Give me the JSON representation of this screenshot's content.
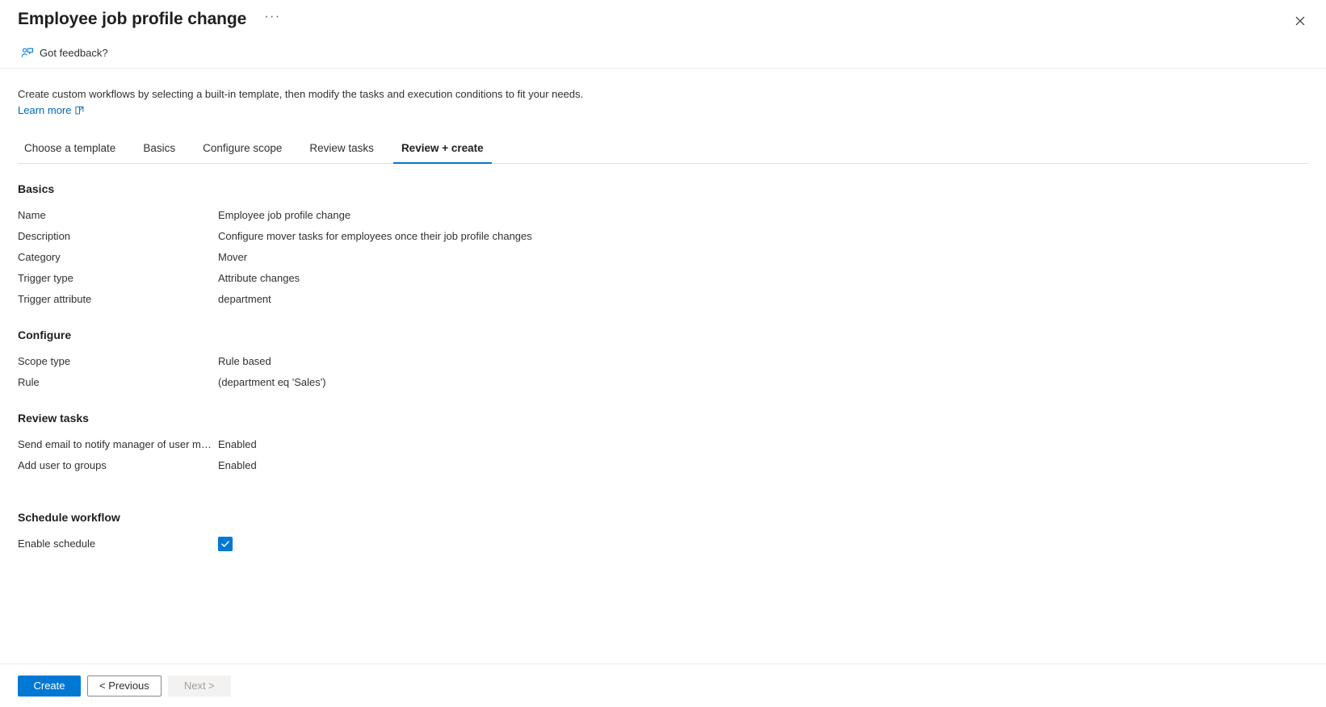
{
  "blade": {
    "title": "Employee job profile change",
    "ellipsis_label": "···",
    "close_label": "Close"
  },
  "commandbar": {
    "feedback_label": "Got feedback?"
  },
  "intro": {
    "text": "Create custom workflows by selecting a built-in template, then modify the tasks and execution conditions to fit your needs.",
    "learn_more_label": "Learn more"
  },
  "tabs": [
    {
      "label": "Choose a template",
      "active": false
    },
    {
      "label": "Basics",
      "active": false
    },
    {
      "label": "Configure scope",
      "active": false
    },
    {
      "label": "Review tasks",
      "active": false
    },
    {
      "label": "Review + create",
      "active": true
    }
  ],
  "sections": {
    "basics": {
      "title": "Basics",
      "rows": [
        {
          "key": "Name",
          "value": "Employee job profile change"
        },
        {
          "key": "Description",
          "value": "Configure mover tasks for employees once their job profile changes"
        },
        {
          "key": "Category",
          "value": "Mover"
        },
        {
          "key": "Trigger type",
          "value": "Attribute changes"
        },
        {
          "key": "Trigger attribute",
          "value": "department"
        }
      ]
    },
    "configure": {
      "title": "Configure",
      "rows": [
        {
          "key": "Scope type",
          "value": "Rule based"
        },
        {
          "key": "Rule",
          "value": "(department eq 'Sales')"
        }
      ]
    },
    "review_tasks": {
      "title": "Review tasks",
      "rows": [
        {
          "key": "Send email to notify manager of user move",
          "value": "Enabled"
        },
        {
          "key": "Add user to groups",
          "value": "Enabled"
        }
      ]
    },
    "schedule": {
      "title": "Schedule workflow",
      "enable_label": "Enable schedule",
      "enable_checked": true
    }
  },
  "footer": {
    "create_label": "Create",
    "previous_label": "< Previous",
    "next_label": "Next >"
  },
  "colors": {
    "accent": "#0078d4",
    "link": "#0067b8",
    "text": "#323130",
    "disabled_text": "#a19f9d"
  }
}
